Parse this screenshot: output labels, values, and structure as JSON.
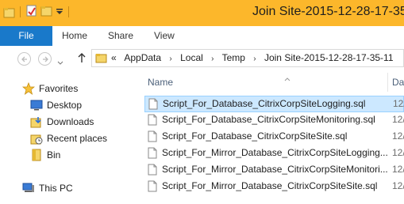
{
  "window": {
    "title": "Join Site-2015-12-28-17-35-"
  },
  "ribbon": {
    "tabs": [
      {
        "label": "File"
      },
      {
        "label": "Home"
      },
      {
        "label": "Share"
      },
      {
        "label": "View"
      }
    ]
  },
  "address": {
    "prefix": "«",
    "crumbs": [
      "AppData",
      "Local",
      "Temp",
      "Join Site-2015-12-28-17-35-11"
    ]
  },
  "nav": {
    "favorites": "Favorites",
    "items": [
      "Desktop",
      "Downloads",
      "Recent places",
      "Bin"
    ],
    "this_pc": "This PC"
  },
  "files": {
    "columns": {
      "name": "Name",
      "date": "Da"
    },
    "rows": [
      {
        "name": "Script_For_Database_CitrixCorpSiteLogging.sql",
        "date": "12/"
      },
      {
        "name": "Script_For_Database_CitrixCorpSiteMonitoring.sql",
        "date": "12/"
      },
      {
        "name": "Script_For_Database_CitrixCorpSiteSite.sql",
        "date": "12/"
      },
      {
        "name": "Script_For_Mirror_Database_CitrixCorpSiteLogging...",
        "date": "12/"
      },
      {
        "name": "Script_For_Mirror_Database_CitrixCorpSiteMonitori...",
        "date": "12/"
      },
      {
        "name": "Script_For_Mirror_Database_CitrixCorpSiteSite.sql",
        "date": "12/"
      }
    ],
    "selected_index": 0
  },
  "colors": {
    "titlebar": "#fcb72b",
    "file_tab": "#1979ca",
    "selection": "#cce8ff"
  }
}
